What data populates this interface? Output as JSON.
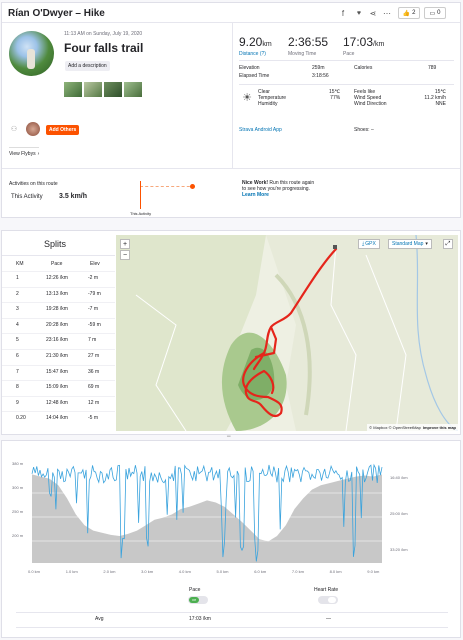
{
  "header": {
    "title": "Rían O'Dwyer – Hike",
    "like_count": "2",
    "comment_count": "0"
  },
  "activity": {
    "datetime": "11:13 AM on Sunday, July 19, 2020",
    "name": "Four falls trail",
    "add_description": "Add a description",
    "add_others": "Add Others",
    "view_flybys": "View Flybys",
    "stats": [
      {
        "value": "9.20",
        "unit": "km",
        "label": "Distance (?)"
      },
      {
        "value": "2:36:55",
        "unit": "",
        "label": "Moving Time"
      },
      {
        "value": "17:03",
        "unit": "/km",
        "label": "Pace"
      }
    ],
    "details": [
      {
        "label": "Elevation",
        "value": "259m"
      },
      {
        "label": "Elapsed Time",
        "value": "3:18:56"
      }
    ],
    "calories": {
      "label": "Calories",
      "value": "789"
    },
    "weather": [
      {
        "label": "Clear",
        "value": ""
      },
      {
        "label": "Temperature",
        "value": "15℃"
      },
      {
        "label": "Humidity",
        "value": "77%"
      }
    ],
    "weather_right": [
      {
        "label": "Feels like",
        "value": "15℃"
      },
      {
        "label": "Wind Speed",
        "value": "11.2 km/h"
      },
      {
        "label": "Wind Direction",
        "value": "NNE"
      }
    ],
    "device": "Strava Android App",
    "shoes": "Shoes: –"
  },
  "activities_on_route": {
    "heading": "Activities on this route",
    "this_activity_label": "This Activity",
    "this_activity_value": "3.5 km/h",
    "marker_label": "This Activity",
    "nice_work": "Nice Work!",
    "nice_text_1": "Run this route again",
    "nice_text_2": "to see how you're progressing.",
    "learn_more": "Learn More"
  },
  "splits": {
    "title": "Splits",
    "headers": [
      "KM",
      "Pace",
      "Elev"
    ],
    "rows": [
      [
        "1",
        "12:26 /km",
        "-2 m"
      ],
      [
        "2",
        "13:13 /km",
        "-79 m"
      ],
      [
        "3",
        "19:28 /km",
        "-7 m"
      ],
      [
        "4",
        "20:28 /km",
        "-59 m"
      ],
      [
        "5",
        "23:16 /km",
        "7 m"
      ],
      [
        "6",
        "21:30 /km",
        "27 m"
      ],
      [
        "7",
        "15:47 /km",
        "36 m"
      ],
      [
        "8",
        "15:09 /km",
        "69 m"
      ],
      [
        "9",
        "12:48 /km",
        "12 m"
      ],
      [
        "0.20",
        "14:04 /km",
        "-5 m"
      ]
    ]
  },
  "map": {
    "gpx": "GPX",
    "map_type": "Standard Map",
    "attribution_1": "© Mapbox © OpenStreetMap",
    "attribution_2": "Improve this map"
  },
  "chart": {
    "y_left_ticks": [
      "380 m",
      "300 m",
      "250 m",
      "200 m"
    ],
    "y_right_ticks": [
      "16:40 /km",
      "25:00 /km",
      "33:20 /km"
    ],
    "x_ticks": [
      "0.0 km",
      "1.0 km",
      "2.0 km",
      "3.0 km",
      "4.0 km",
      "5.0 km",
      "6.0 km",
      "7.0 km",
      "8.0 km",
      "9.0 km"
    ],
    "pace_label": "Pace",
    "pace_toggle": "Off",
    "heart_label": "Heart Rate",
    "avg_label": "Avg",
    "avg_pace": "17:03 /km",
    "avg_hr": "—"
  },
  "colors": {
    "accent": "#fc5200",
    "link": "#0073b3",
    "route": "#e5251b",
    "pace_line": "#3aa3dd",
    "elevation_fill": "#c8c8c8"
  }
}
